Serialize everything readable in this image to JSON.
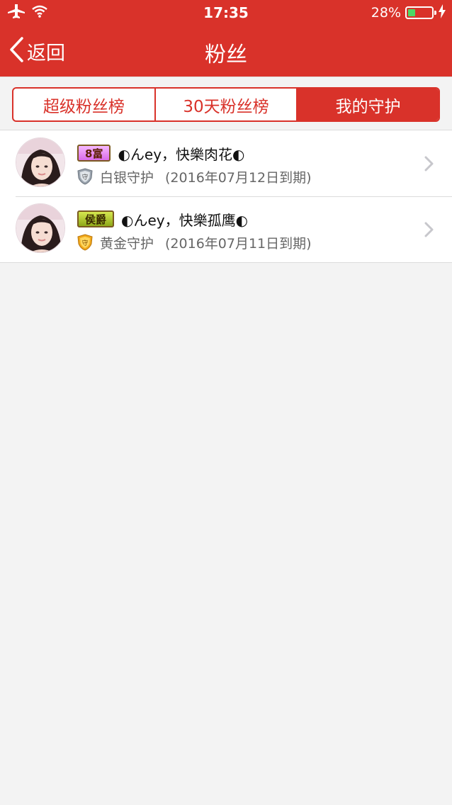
{
  "status_bar": {
    "time": "17:35",
    "battery_percent": "28%",
    "battery_level": 0.28,
    "icons": [
      "airplane-icon",
      "wifi-icon",
      "battery-icon",
      "charging-bolt-icon"
    ]
  },
  "nav": {
    "back_label": "返回",
    "title": "粉丝"
  },
  "tabs": [
    {
      "label": "超级粉丝榜",
      "active": false
    },
    {
      "label": "30天粉丝榜",
      "active": false
    },
    {
      "label": "我的守护",
      "active": true
    }
  ],
  "guards": [
    {
      "badge": "8富",
      "nickname": "◐んey，快樂肉花◐",
      "guard_type": "白银守护",
      "shield_glyph": "守",
      "expiry": "(2016年07月12日到期)"
    },
    {
      "badge": "侯爵",
      "nickname": "◐んey，快樂孤鹰◐",
      "guard_type": "黄金守护",
      "shield_glyph": "守",
      "expiry": "(2016年07月11日到期)"
    }
  ],
  "colors": {
    "accent": "#d9322a",
    "background": "#f3f3f3",
    "silver_shield": "#9aa3ad",
    "gold_shield": "#f0a81c"
  }
}
